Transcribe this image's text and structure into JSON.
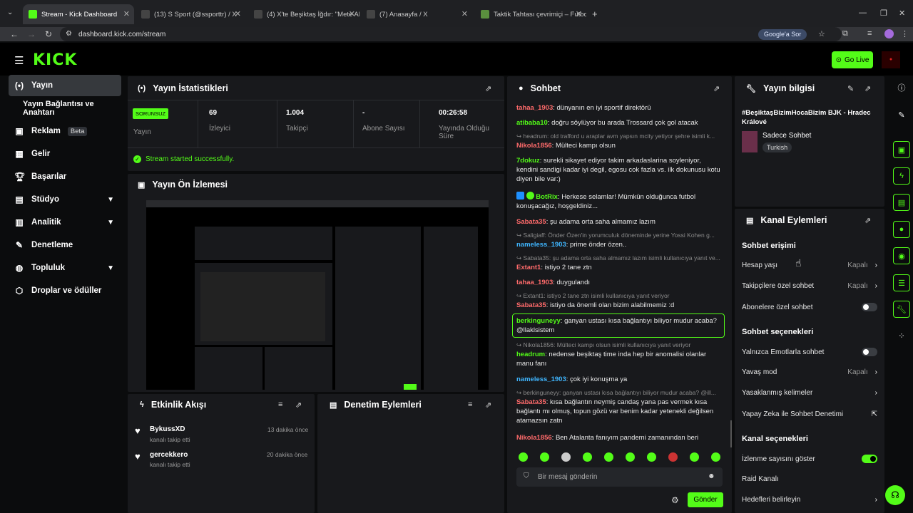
{
  "browser": {
    "tabs": [
      {
        "title": "Stream - Kick Dashboard",
        "color": "#53fc18"
      },
      {
        "title": "(13) S Sport (@ssporttr) / X",
        "color": "#000"
      },
      {
        "title": "(4) X'te Beşiktaş İğdır: \"Mete Al...",
        "color": "#000"
      },
      {
        "title": "(7) Anasayfa / X",
        "color": "#000"
      },
      {
        "title": "Taktik Tahtası çevrimiçi – Futbol...",
        "color": "#5a8f3e"
      }
    ],
    "url": "dashboard.kick.com/stream",
    "google_btn": "Google'a Sor"
  },
  "header": {
    "logo": "KICK",
    "go_live": "Go Live"
  },
  "sidebar": {
    "items": [
      {
        "label": "Yayın",
        "icon": "broadcast-icon"
      },
      {
        "label": "Yayın Bağlantısı ve Anahtarı"
      },
      {
        "label": "Reklam",
        "badge": "Beta",
        "icon": "ad-icon"
      },
      {
        "label": "Gelir",
        "icon": "revenue-icon"
      },
      {
        "label": "Başarılar",
        "icon": "trophy-icon"
      },
      {
        "label": "Stüdyo",
        "icon": "studio-icon"
      },
      {
        "label": "Analitik",
        "icon": "chart-icon"
      },
      {
        "label": "Denetleme",
        "icon": "wrench-icon"
      },
      {
        "label": "Topluluk",
        "icon": "community-icon"
      },
      {
        "label": "Droplar ve ödüller",
        "icon": "gift-icon"
      }
    ]
  },
  "stats": {
    "title": "Yayın İstatistikleri",
    "status": "SORUNSUZ",
    "status_label": "Yayın",
    "viewers": "69",
    "viewers_label": "İzleyici",
    "followers": "1.004",
    "followers_label": "Takipçi",
    "subs": "-",
    "subs_label": "Abone Sayısı",
    "uptime": "00:26:58",
    "uptime_label": "Yayında Olduğu Süre",
    "success": "Stream started successfully."
  },
  "preview": {
    "title": "Yayın Ön İzlemesi"
  },
  "activity": {
    "title": "Etkinlik Akışı",
    "items": [
      {
        "user": "BykussXD",
        "action": "kanalı takip etti",
        "time": "13 dakika önce"
      },
      {
        "user": "gercekkero",
        "action": "kanalı takip etti",
        "time": "20 dakika önce"
      }
    ]
  },
  "moderation": {
    "title": "Denetim Eylemleri"
  },
  "chat": {
    "title": "Sohbet",
    "placeholder": "Bir mesaj gönderin",
    "send": "Gönder",
    "messages": [
      {
        "user": "tahaa_1903",
        "text": "dünyanın en iyi sportif direktörü",
        "color": "#ff6b6b"
      },
      {
        "user": "atibaba10",
        "text": "doğru söylüyor bu arada Trossard çok gol atacak",
        "color": "#53fc18"
      },
      {
        "reply": "headrum: old trafford u araplar avm yapsın mcity yetiyor şehre isimli k..."
      },
      {
        "user": "Nikola1856",
        "text": "Mülteci kampı olsun",
        "color": "#ff6b6b"
      },
      {
        "user": "7dokuz",
        "text": "surekli sikayet ediyor takim arkadaslarina soyleniyor, kendini sandigi kadar iyi degil, egosu cok fazla vs. ilk dokunusu kotu diyen bile var:)",
        "color": "#53fc18"
      },
      {
        "user": "BotRix",
        "text": "Herkese selamlar! Mümkün olduğunca futbol konuşacağız, hoşgeldiniz...",
        "color": "#53fc18"
      },
      {
        "user": "Sabata35",
        "text": "şu adama orta saha almamız lazım",
        "color": "#ff6b6b"
      },
      {
        "reply": "Saligiaff: Önder Özen'in yorumculuk döneminde yerine Yossi Kohen g..."
      },
      {
        "user": "nameless_1903",
        "text": "prime önder özen..",
        "color": "#3fb6ff"
      },
      {
        "reply": "Sabata35: şu adama orta saha almamız lazım isimli kullanıcıya yanıt ve..."
      },
      {
        "user": "Extant1",
        "text": "istiyo 2 tane ztn",
        "color": "#ff6b6b"
      },
      {
        "user": "tahaa_1903",
        "text": "duygulandı",
        "color": "#ff6b6b"
      },
      {
        "reply": "Extant1: istiyo 2 tane ztn isimli kullanıcıya yanıt veriyor"
      },
      {
        "user": "Sabata35",
        "text": "istiyo da önemli olan bizim alabilmemiz :d",
        "color": "#ff6b6b"
      },
      {
        "user": "berkinguneyy",
        "text": "ganyan ustası kısa bağlantıyı biliyor mudur acaba? @llaklsistem",
        "color": "#53fc18"
      },
      {
        "reply": "Nikola1856: Mülteci kampı olsun isimli kullanıcıya yanıt veriyor"
      },
      {
        "user": "headrum",
        "text": "nedense beşiktaş time inda hep bir anomalisi olanlar manu fanı",
        "color": "#53fc18"
      },
      {
        "user": "nameless_1903",
        "text": "çok iyi konuşma ya",
        "color": "#3fb6ff"
      },
      {
        "reply": "berkinguneyy: ganyan ustası kısa bağlantıyı biliyor mudur acaba? @ill..."
      },
      {
        "user": "Sabata35",
        "text": "kısa bağlantın neymiş candaş yana pas vermek kısa bağlantı mı olmuş, topun gözü var benim kadar yetenekli değilsen atamazsın zatn",
        "color": "#ff6b6b"
      },
      {
        "user": "Nikola1856",
        "text": "Ben Atalanta fanıyım pandemi zamanından beri",
        "color": "#ff6b6b"
      }
    ]
  },
  "info": {
    "title": "Yayın bilgisi",
    "stream_title": "#BeşiktaşBizimHocaBizim BJK - Hradec Králové",
    "category": "Sadece Sohbet",
    "tag": "Turkish"
  },
  "channel": {
    "title": "Kanal Eylemleri",
    "sec1": "Sohbet erişimi",
    "sec2": "Sohbet seçenekleri",
    "sec3": "Kanal seçenekleri",
    "rows": [
      {
        "label": "Hesap yaşı",
        "value": "Kapalı"
      },
      {
        "label": "Takipçilere özel sohbet",
        "value": "Kapalı"
      },
      {
        "label": "Abonelere özel sohbet"
      },
      {
        "label": "Yalnızca Emotlarla sohbet"
      },
      {
        "label": "Yavaş mod",
        "value": "Kapalı"
      },
      {
        "label": "Yasaklanmış kelimeler"
      },
      {
        "label": "Yapay Zeka ile Sohbet Denetimi"
      },
      {
        "label": "İzlenme sayısını göster"
      },
      {
        "label": "Raid Kanalı"
      },
      {
        "label": "Hedefleri belirleyin"
      }
    ]
  },
  "colors": {
    "accent": "#53fc18"
  }
}
